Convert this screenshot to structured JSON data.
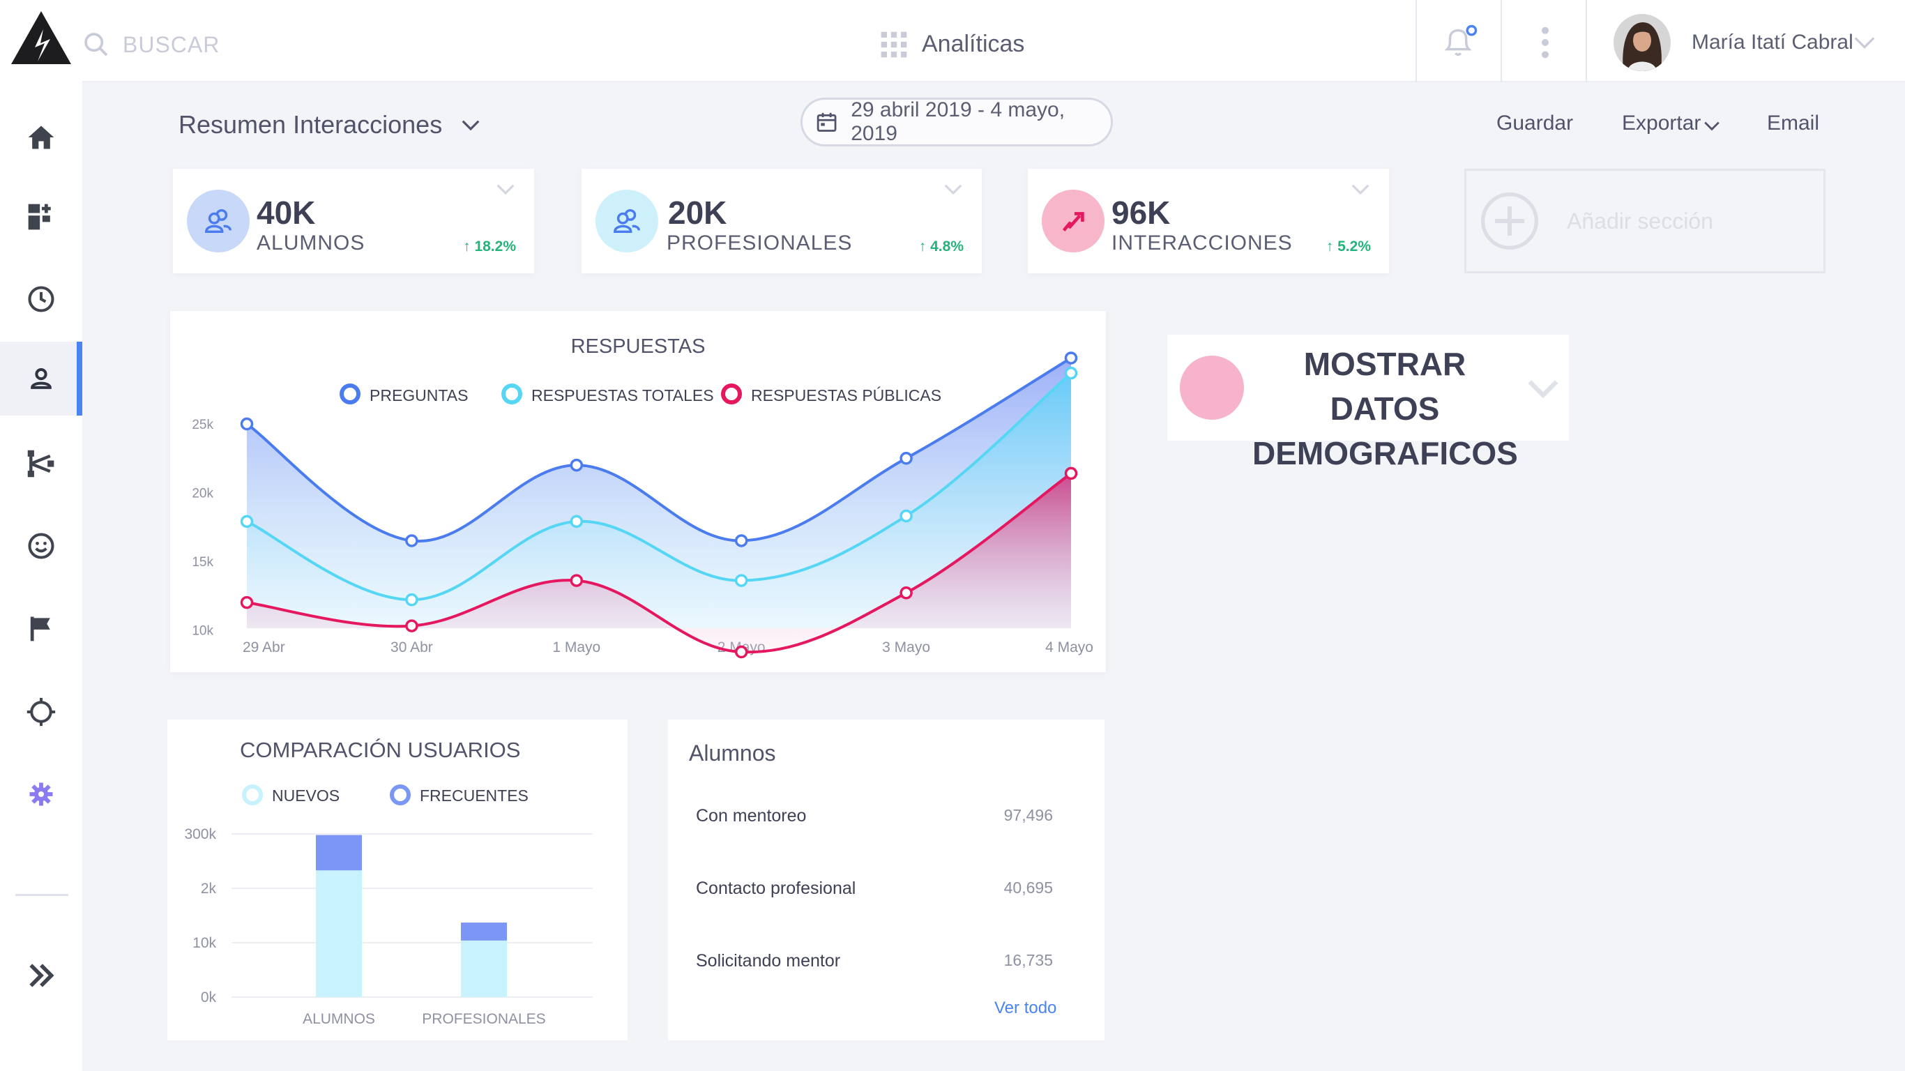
{
  "search": {
    "placeholder": "BUSCAR"
  },
  "header": {
    "section_title": "Analíticas",
    "user_name": "María Itatí Cabral"
  },
  "toolbar": {
    "title": "Resumen Interacciones",
    "date_range": "29 abril 2019 - 4 mayo, 2019",
    "save_label": "Guardar",
    "export_label": "Exportar",
    "email_label": "Email"
  },
  "kpis": [
    {
      "value": "40K",
      "label": "ALUMNOS",
      "delta": "18.2%",
      "color": "#c8d8f8",
      "icon": "users-icon"
    },
    {
      "value": "20K",
      "label": "PROFESIONALES",
      "delta": "4.8%",
      "color": "#cdf0fb",
      "icon": "users-icon"
    },
    {
      "value": "96K",
      "label": "INTERACCIONES",
      "delta": "5.2%",
      "color": "#f8b6ca",
      "icon": "trend-icon"
    }
  ],
  "add_section_label": "Añadir sección",
  "demographics": {
    "title": "MOSTRAR DATOS DEMOGRAFICOS"
  },
  "sidebar": {
    "items": [
      {
        "name": "home-icon"
      },
      {
        "name": "dashboard-add-icon"
      },
      {
        "name": "clock-icon"
      },
      {
        "name": "user-icon",
        "active": true
      },
      {
        "name": "share-icon"
      },
      {
        "name": "smile-icon"
      },
      {
        "name": "flag-icon"
      },
      {
        "name": "crosshair-icon"
      },
      {
        "name": "gear-icon"
      }
    ],
    "expand_icon": "double-chevron-right-icon"
  },
  "colors": {
    "accent": "#4a84f2",
    "preguntas": "#4a7cf0",
    "totales": "#56d6f5",
    "publicas": "#e5175f",
    "positive": "#24b37a"
  },
  "chart_data": [
    {
      "type": "area",
      "title": "RESPUESTAS",
      "categories": [
        "29 Abr",
        "30 Abr",
        "1 Mayo",
        "2 Mayo",
        "3 Mayo",
        "4 Mayo"
      ],
      "y_ticks": [
        "25k",
        "20k",
        "15k",
        "10k"
      ],
      "ylim": [
        9000,
        26000
      ],
      "legend_position": "top",
      "series": [
        {
          "name": "PREGUNTAS",
          "color": "#4a7cf0",
          "points": [
            [
              0,
              25000
            ],
            [
              1,
              16500
            ],
            [
              2,
              22000
            ],
            [
              3,
              16500
            ],
            [
              4,
              22500
            ],
            [
              5,
              29800
            ]
          ]
        },
        {
          "name": "RESPUESTAS TOTALES",
          "color": "#56d6f5",
          "points": [
            [
              0,
              17900
            ],
            [
              1,
              12200
            ],
            [
              2,
              17900
            ],
            [
              3,
              13600
            ],
            [
              4,
              18300
            ],
            [
              5,
              28700
            ]
          ]
        },
        {
          "name": "RESPUESTAS PÚBLICAS",
          "color": "#e5175f",
          "points": [
            [
              0,
              12000
            ],
            [
              1,
              10300
            ],
            [
              2,
              13600
            ],
            [
              3,
              8400
            ],
            [
              4,
              12700
            ],
            [
              5,
              21400
            ]
          ]
        }
      ]
    },
    {
      "type": "bar",
      "title": "COMPARACIÓN USUARIOS",
      "categories": [
        "ALUMNOS",
        "PROFESIONALES"
      ],
      "y_ticks": [
        "300k",
        "2k",
        "10k",
        "0k"
      ],
      "ylim": [
        0,
        3
      ],
      "legend_position": "top",
      "stacked": true,
      "series": [
        {
          "name": "NUEVOS",
          "color": "#c8f2fd",
          "values": [
            2.33,
            1.04
          ]
        },
        {
          "name": "FRECUENTES",
          "color": "#7b96f4",
          "values": [
            0.65,
            0.33
          ]
        }
      ]
    }
  ],
  "alumnos_table": {
    "title": "Alumnos",
    "rows": [
      {
        "label": "Con mentoreo",
        "value": "97,496"
      },
      {
        "label": "Contacto profesional",
        "value": "40,695"
      },
      {
        "label": "Solicitando mentor",
        "value": "16,735"
      }
    ],
    "see_all": "Ver todo"
  }
}
